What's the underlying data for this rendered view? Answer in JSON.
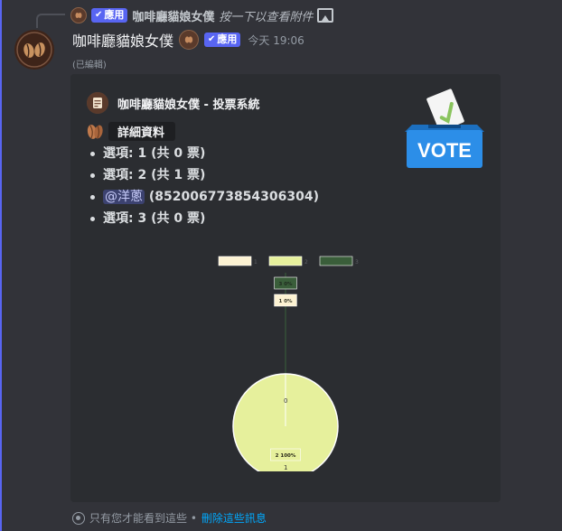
{
  "reply": {
    "badge_label": "應用",
    "author": "咖啡廳貓娘女僕",
    "text": "按一下以查看附件"
  },
  "message": {
    "author": "咖啡廳貓娘女僕",
    "badge_label": "應用",
    "timestamp": "今天 19:06",
    "edited": "(已編輯)"
  },
  "embed": {
    "author_name": "咖啡廳貓娘女僕 - 投票系統",
    "detail_label": "詳細資料",
    "vote_image_text": "VOTE",
    "options": [
      {
        "text": "選項: 1 (共 0 票)"
      },
      {
        "text": "選項: 2 (共 1 票)"
      },
      {
        "mention": "@洋蔥",
        "rest": " (852006773854306304)"
      },
      {
        "text": "選項: 3 (共 0 票)"
      }
    ]
  },
  "chart_data": {
    "type": "pie",
    "categories": [
      "1",
      "2",
      "3"
    ],
    "values": [
      0,
      1,
      0
    ],
    "slice_labels": [
      "1 0%",
      "2 100%",
      "3 0%"
    ],
    "inner_labels": [
      "0",
      "1"
    ],
    "colors": [
      "#fdf3d3",
      "#e6f09c",
      "#3a5e3a"
    ],
    "legend": "top"
  },
  "footer": {
    "notice": "只有您才能看到這些 •",
    "link": "刪除這些訊息"
  }
}
